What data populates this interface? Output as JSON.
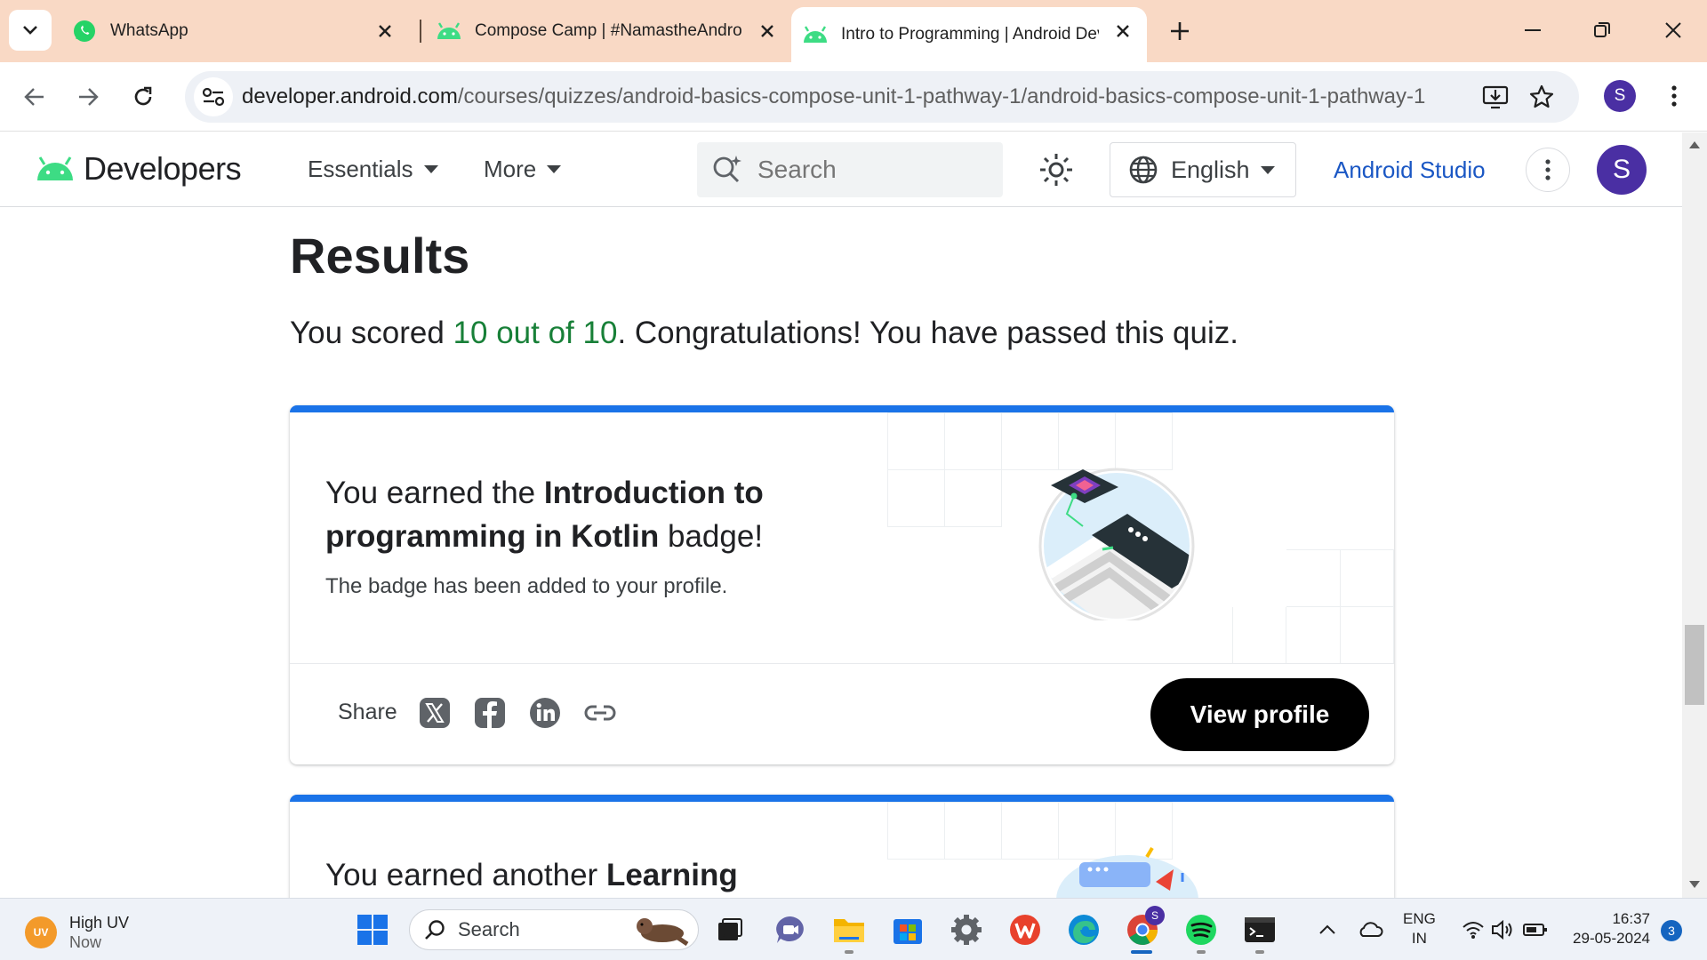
{
  "browser": {
    "tabs": [
      {
        "title": "WhatsApp"
      },
      {
        "title": "Compose Camp | #NamastheAndroid"
      },
      {
        "title": "Intro to Programming  |  Android Developers"
      }
    ],
    "url_host": "developer.android.com",
    "url_path": "/courses/quizzes/android-basics-compose-unit-1-pathway-1/android-basics-compose-unit-1-pathway-1",
    "profile_initial": "S"
  },
  "site": {
    "logo_text": "Developers",
    "nav": {
      "essentials": "Essentials",
      "more": "More"
    },
    "search_placeholder": "Search",
    "language": "English",
    "studio_link": "Android Studio",
    "avatar_initial": "S"
  },
  "results": {
    "title": "Results",
    "score_prefix": "You scored ",
    "score_value": "10 out of 10",
    "score_suffix": ". Congratulations! You have passed this quiz."
  },
  "badge_card": {
    "headline_prefix": "You earned the ",
    "badge_name": "Introduction to programming in Kotlin",
    "headline_suffix": " badge!",
    "subtext": "The badge has been added to your profile.",
    "share_label": "Share",
    "view_profile": "View profile"
  },
  "second_card": {
    "headline_prefix": "You earned another ",
    "headline_bold": "Learning"
  },
  "taskbar": {
    "weather_title": "High UV",
    "weather_sub": "Now",
    "weather_badge": "UV",
    "search_label": "Search",
    "lang_line1": "ENG",
    "lang_line2": "IN",
    "time": "16:37",
    "date": "29-05-2024",
    "notif_count": "3",
    "chrome_badge": "S"
  },
  "colors": {
    "accent_blue": "#1a73e8",
    "score_green": "#188038",
    "tab_strip": "#f9d9c5",
    "avatar_purple": "#4a2fa3",
    "android_green": "#3ddc84"
  }
}
